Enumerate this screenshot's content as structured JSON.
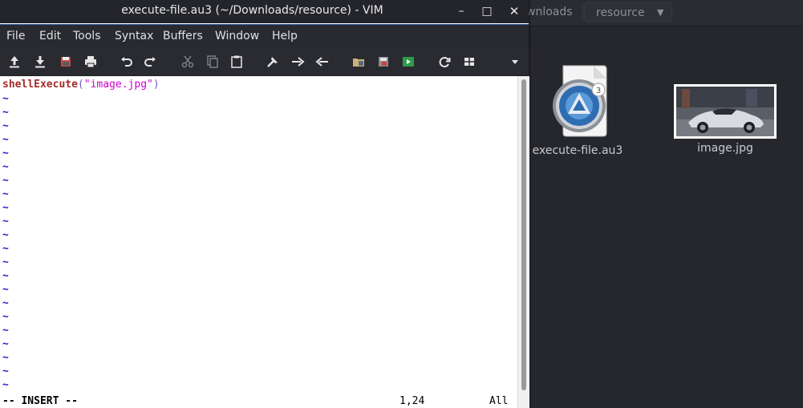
{
  "file_manager": {
    "breadcrumbs": [
      "wnloads",
      "resource"
    ],
    "items": [
      {
        "name": "execute-file.au3",
        "icon": "autoit-script-icon"
      },
      {
        "name": "image.jpg",
        "icon": "car-image-thumbnail"
      }
    ]
  },
  "vim": {
    "title": "execute-file.au3 (~/Downloads/resource) - VIM",
    "window_controls": {
      "minimize": "–",
      "maximize": "□",
      "close": "✕"
    },
    "menu": [
      "File",
      "Edit",
      "Tools",
      "Syntax",
      "Buffers",
      "Window",
      "Help"
    ],
    "toolbar_icons": [
      "open-icon",
      "save-icon",
      "save-all-icon",
      "print-icon",
      "undo-icon",
      "redo-icon",
      "cut-icon",
      "copy-icon",
      "paste-icon",
      "replace-icon",
      "find-next-icon",
      "find-prev-icon",
      "load-session-icon",
      "save-session-icon",
      "run-script-icon",
      "make-icon",
      "tags-icon",
      "overflow-chevron-icon"
    ],
    "code": {
      "function": "shellExecute",
      "open_paren": "(",
      "string": "\"image.jpg\"",
      "close_paren": ")"
    },
    "tilde": "~",
    "status": {
      "mode": "-- INSERT --",
      "position": "1,24",
      "scroll": "All"
    }
  },
  "colors": {
    "vim_tilde": "#1d1dc8",
    "vim_function": "#a52a2a",
    "vim_string": "#cc00cc",
    "titlebar": "#24252a"
  }
}
